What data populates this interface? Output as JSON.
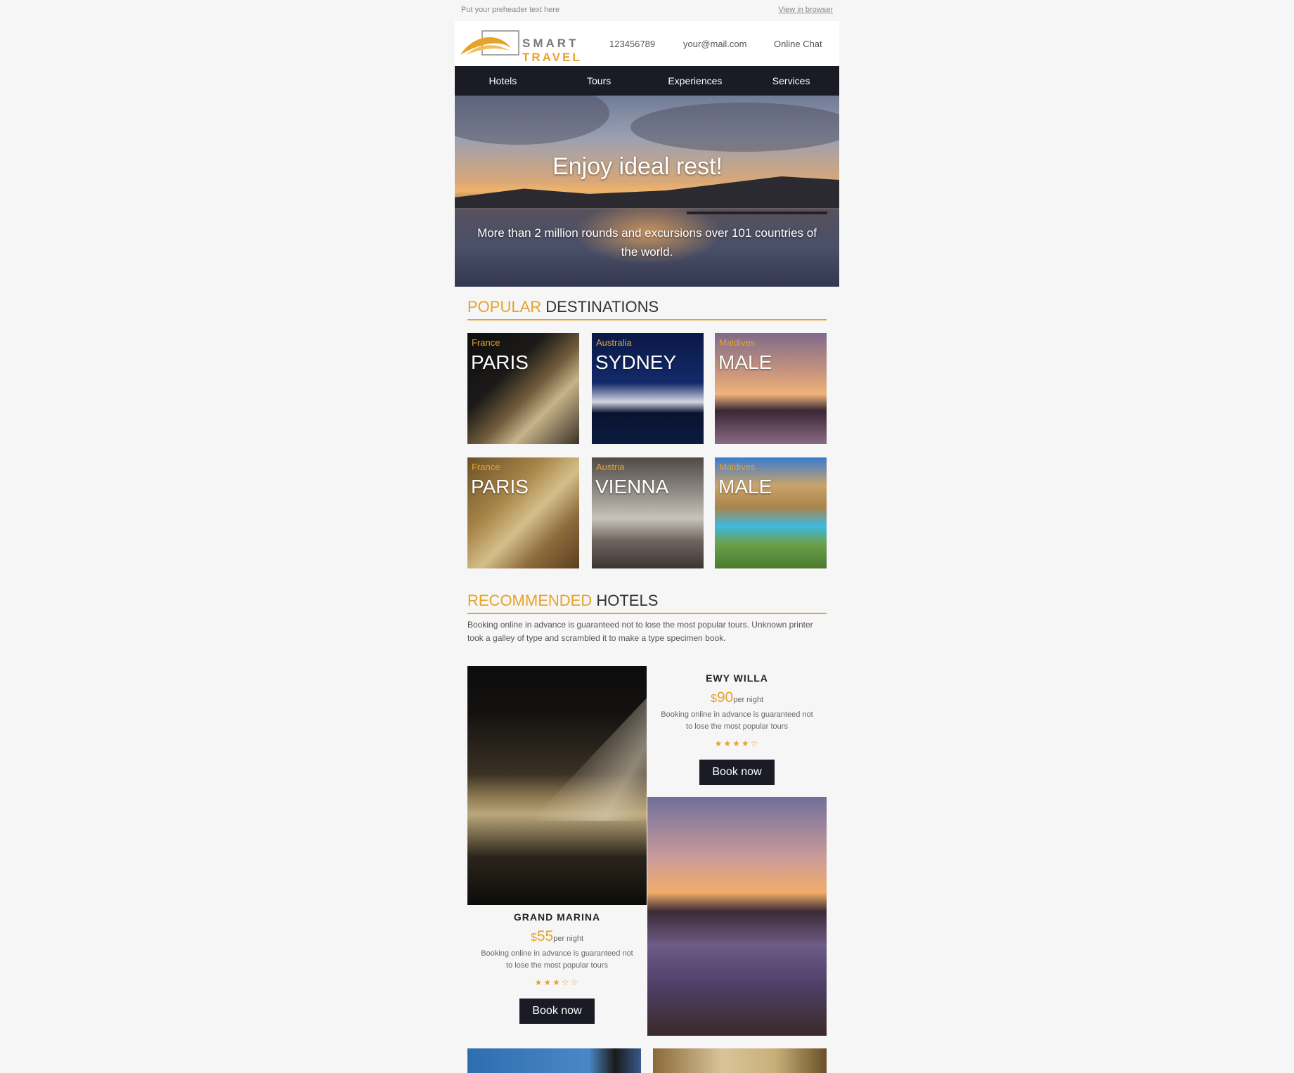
{
  "preheader": {
    "text": "Put your preheader text here",
    "view_link": "View in browser"
  },
  "header": {
    "logo_top": "SMART",
    "logo_bottom": "TRAVEL",
    "phone": "123456789",
    "email": "your@mail.com",
    "chat": "Online Chat"
  },
  "nav": {
    "items": [
      "Hotels",
      "Tours",
      "Experiences",
      "Services"
    ]
  },
  "hero": {
    "title": "Enjoy ideal rest!",
    "subtitle": "More than 2 million rounds and excursions over 101 countries of the world."
  },
  "destinations_heading": {
    "accent": "POPULAR",
    "rest": " DESTINATIONS"
  },
  "destinations": [
    {
      "country": "France",
      "city": "PARIS"
    },
    {
      "country": "Australia",
      "city": "SYDNEY"
    },
    {
      "country": "Maldives",
      "city": "MALE"
    },
    {
      "country": "France",
      "city": "PARIS"
    },
    {
      "country": "Austria",
      "city": "VIENNA"
    },
    {
      "country": "Maldives",
      "city": "MALE"
    }
  ],
  "hotels_heading": {
    "accent": "RECOMMENDED",
    "rest": " HOTELS"
  },
  "hotels_intro": "Booking online in advance is guaranteed not to lose the most popular tours. Unknown printer took a galley of type and scrambled it to make a type specimen book.",
  "hotels": [
    {
      "name": "EWY WILLA",
      "currency": "$",
      "price": "90",
      "per": "per night",
      "desc": "Booking online in advance is guaranteed not to lose the most popular tours",
      "stars": "★★★★☆",
      "rating": 4,
      "button": "Book now"
    },
    {
      "name": "GRAND MARINA",
      "currency": "$",
      "price": "55",
      "per": "per night",
      "desc": "Booking online in advance is guaranteed not to lose the most popular tours",
      "stars": "★★★☆☆",
      "rating": 3,
      "button": "Book now"
    }
  ],
  "colors": {
    "accent": "#e7a22a",
    "dark": "#1a1b24",
    "background": "#f6f6f6"
  }
}
